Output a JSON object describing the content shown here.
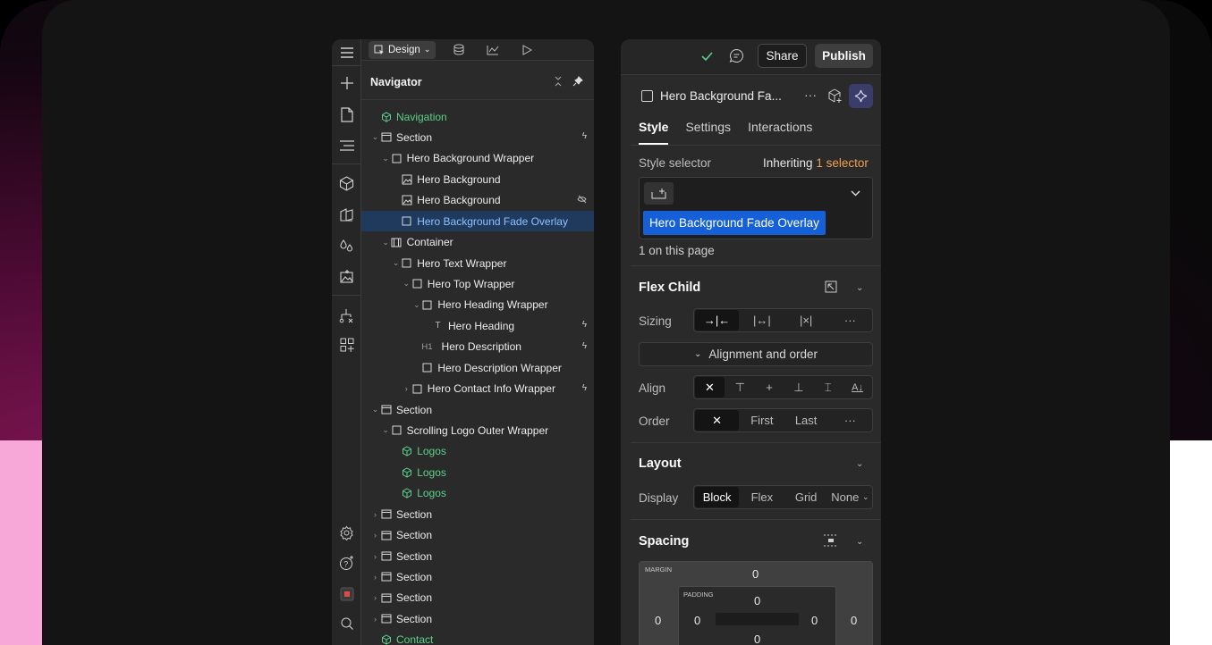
{
  "toolbar": {
    "design_mode": "Design"
  },
  "navigator": {
    "title": "Navigator",
    "rows": [
      {
        "label": "Navigation",
        "depth": 0,
        "type": "component",
        "caret": "",
        "flag": ""
      },
      {
        "label": "Section",
        "depth": 0,
        "type": "section",
        "caret": "⌄",
        "flag": "ϟ"
      },
      {
        "label": "Hero Background Wrapper",
        "depth": 1,
        "type": "div",
        "caret": "⌄",
        "flag": ""
      },
      {
        "label": "Hero Background",
        "depth": 2,
        "type": "image",
        "caret": "",
        "flag": ""
      },
      {
        "label": "Hero Background",
        "depth": 2,
        "type": "image",
        "caret": "",
        "flag": "hidden"
      },
      {
        "label": "Hero Background Fade Overlay",
        "depth": 2,
        "type": "div",
        "caret": "",
        "flag": "",
        "selected": true
      },
      {
        "label": "Container",
        "depth": 1,
        "type": "container",
        "caret": "⌄",
        "flag": ""
      },
      {
        "label": "Hero Text Wrapper",
        "depth": 2,
        "type": "div",
        "caret": "⌄",
        "flag": ""
      },
      {
        "label": "Hero Top Wrapper",
        "depth": 3,
        "type": "div",
        "caret": "⌄",
        "flag": ""
      },
      {
        "label": "Hero Heading Wrapper",
        "depth": 4,
        "type": "div",
        "caret": "⌄",
        "flag": ""
      },
      {
        "label": "Hero Heading",
        "depth": 5,
        "type": "text",
        "caret": "",
        "flag": "ϟ"
      },
      {
        "label": "Hero Description",
        "depth": 4,
        "type": "h1",
        "caret": "",
        "flag": "ϟ"
      },
      {
        "label": "Hero Description Wrapper",
        "depth": 4,
        "type": "div",
        "caret": "",
        "flag": ""
      },
      {
        "label": "Hero Contact Info Wrapper",
        "depth": 3,
        "type": "div",
        "caret": "›",
        "flag": "ϟ"
      },
      {
        "label": "Section",
        "depth": 0,
        "type": "section",
        "caret": "⌄",
        "flag": ""
      },
      {
        "label": "Scrolling Logo Outer Wrapper",
        "depth": 1,
        "type": "div",
        "caret": "⌄",
        "flag": ""
      },
      {
        "label": "Logos",
        "depth": 2,
        "type": "component",
        "caret": "",
        "flag": ""
      },
      {
        "label": "Logos",
        "depth": 2,
        "type": "component",
        "caret": "",
        "flag": ""
      },
      {
        "label": "Logos",
        "depth": 2,
        "type": "component",
        "caret": "",
        "flag": ""
      },
      {
        "label": "Section",
        "depth": 0,
        "type": "section",
        "caret": "›",
        "flag": ""
      },
      {
        "label": "Section",
        "depth": 0,
        "type": "section",
        "caret": "›",
        "flag": ""
      },
      {
        "label": "Section",
        "depth": 0,
        "type": "section",
        "caret": "›",
        "flag": ""
      },
      {
        "label": "Section",
        "depth": 0,
        "type": "section",
        "caret": "›",
        "flag": ""
      },
      {
        "label": "Section",
        "depth": 0,
        "type": "section",
        "caret": "›",
        "flag": ""
      },
      {
        "label": "Section",
        "depth": 0,
        "type": "section",
        "caret": "›",
        "flag": ""
      },
      {
        "label": "Contact",
        "depth": 0,
        "type": "component",
        "caret": "",
        "flag": ""
      }
    ]
  },
  "topbar": {
    "share_label": "Share",
    "publish_label": "Publish"
  },
  "element": {
    "name": "Hero Background Fa...",
    "more": "···"
  },
  "tabs": [
    "Style",
    "Settings",
    "Interactions"
  ],
  "style_selector": {
    "label": "Style selector",
    "inheriting_prefix": "Inheriting",
    "inheriting_count": "1 selector",
    "chip": "Hero Background Fade Overlay",
    "on_page": "1 on this page"
  },
  "flex_child": {
    "title": "Flex Child",
    "sizing_label": "Sizing",
    "sizing_more": "···",
    "alignment_toggle": "Alignment and order",
    "align_label": "Align",
    "order_label": "Order",
    "order_options": [
      "First",
      "Last"
    ],
    "order_more": "···"
  },
  "layout": {
    "title": "Layout",
    "display_label": "Display",
    "display_options": [
      "Block",
      "Flex",
      "Grid",
      "None"
    ],
    "selected": "Block"
  },
  "spacing": {
    "title": "Spacing",
    "margin_label": "MARGIN",
    "padding_label": "PADDING",
    "margin_top": "0",
    "margin_left": "0",
    "margin_right": "0",
    "padding_top": "0",
    "padding_left": "0",
    "padding_right": "0",
    "padding_bottom": "0"
  },
  "colors": {
    "accent_blue": "#1560d6",
    "selected_row": "#1f3a5c",
    "component_green": "#5cd08a",
    "inherit_orange": "#f0a050",
    "ai_button": "#3a3d6a"
  }
}
